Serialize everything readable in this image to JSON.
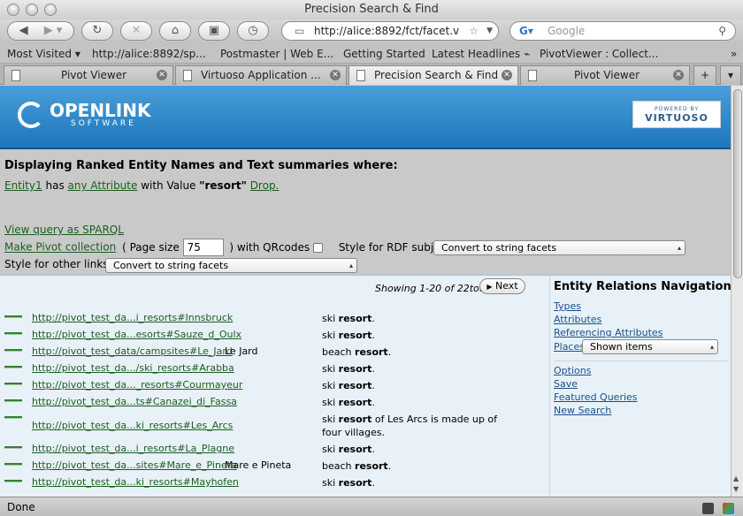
{
  "window": {
    "title": "Precision Search & Find"
  },
  "toolbar": {
    "back_icon": "back-arrow",
    "forward_icon": "forward-arrow",
    "url": "http://alice:8892/fct/facet.v",
    "search_placeholder": "Google"
  },
  "bookmarks": [
    "Most Visited ▾",
    "http://alice:8892/sp...",
    "Postmaster | Web E...",
    "Getting Started",
    "Latest Headlines ⌁",
    "PivotViewer : Collect..."
  ],
  "tabs": [
    {
      "label": "Pivot Viewer"
    },
    {
      "label": "Virtuoso Application ..."
    },
    {
      "label": "Precision Search & Find"
    },
    {
      "label": "Pivot Viewer"
    }
  ],
  "branding": {
    "logo_main": "OPENLINK",
    "logo_sub": "SOFTWARE",
    "badge_top": "POWERED BY",
    "badge_main": "VIRTUOSO"
  },
  "description": {
    "heading": "Displaying Ranked Entity Names and Text summaries where:",
    "entity": "Entity1",
    "has": " has ",
    "attribute": "any Attribute",
    "with_value": " with Value ",
    "value": "\"resort\"",
    "drop": "Drop."
  },
  "controls": {
    "view_sparql": "View query as SPARQL",
    "make_pivot": "Make Pivot collection",
    "page_size_label": "( Page size",
    "page_size_value": "75",
    "qrcodes_label": ")  with QRcodes",
    "rdf_style_label": "Style for RDF subjects",
    "rdf_style_value": "Convert to string facets",
    "other_links_label": "Style for other links",
    "other_links_value": "Convert to string facets"
  },
  "results": {
    "showing": "Showing 1-20 of 22total",
    "next": "Next",
    "rows": [
      {
        "uri": "http://pivot_test_da...i_resorts#Innsbruck",
        "label": "",
        "snippet_pre": "ski ",
        "snippet_bold": "resort",
        "snippet_post": "."
      },
      {
        "uri": "http://pivot_test_da...esorts#Sauze_d_Oulx",
        "label": "",
        "snippet_pre": "ski ",
        "snippet_bold": "resort",
        "snippet_post": "."
      },
      {
        "uri": "http://pivot_test_data/campsites#Le_Jard",
        "label": "Le Jard",
        "snippet_pre": "beach ",
        "snippet_bold": "resort",
        "snippet_post": "."
      },
      {
        "uri": "http://pivot_test_da.../ski_resorts#Arabba",
        "label": "",
        "snippet_pre": "ski ",
        "snippet_bold": "resort",
        "snippet_post": "."
      },
      {
        "uri": "http://pivot_test_da..._resorts#Courmayeur",
        "label": "",
        "snippet_pre": "ski ",
        "snippet_bold": "resort",
        "snippet_post": "."
      },
      {
        "uri": "http://pivot_test_da...ts#Canazei_di_Fassa",
        "label": "",
        "snippet_pre": "ski ",
        "snippet_bold": "resort",
        "snippet_post": "."
      },
      {
        "uri": "http://pivot_test_da...ki_resorts#Les_Arcs",
        "label": "",
        "snippet_pre": "ski ",
        "snippet_bold": "resort",
        "snippet_post": " of Les Arcs is made up of four villages.",
        "tall": true
      },
      {
        "uri": "http://pivot_test_da...i_resorts#La_Plagne",
        "label": "",
        "snippet_pre": "ski ",
        "snippet_bold": "resort",
        "snippet_post": "."
      },
      {
        "uri": "http://pivot_test_da...sites#Mare_e_Pineta",
        "label": "Mare e Pineta",
        "snippet_pre": "beach ",
        "snippet_bold": "resort",
        "snippet_post": "."
      },
      {
        "uri": "http://pivot_test_da...ki_resorts#Mayhofen",
        "label": "",
        "snippet_pre": "ski ",
        "snippet_bold": "resort",
        "snippet_post": "."
      }
    ]
  },
  "sidebar": {
    "title": "Entity Relations Navigation",
    "types": "Types",
    "attributes": "Attributes",
    "referencing": "Referencing Attributes",
    "places": "Places",
    "places_select": "Shown items",
    "options": "Options",
    "save": "Save",
    "featured": "Featured Queries",
    "new_search": "New Search"
  },
  "status": {
    "text": "Done"
  }
}
